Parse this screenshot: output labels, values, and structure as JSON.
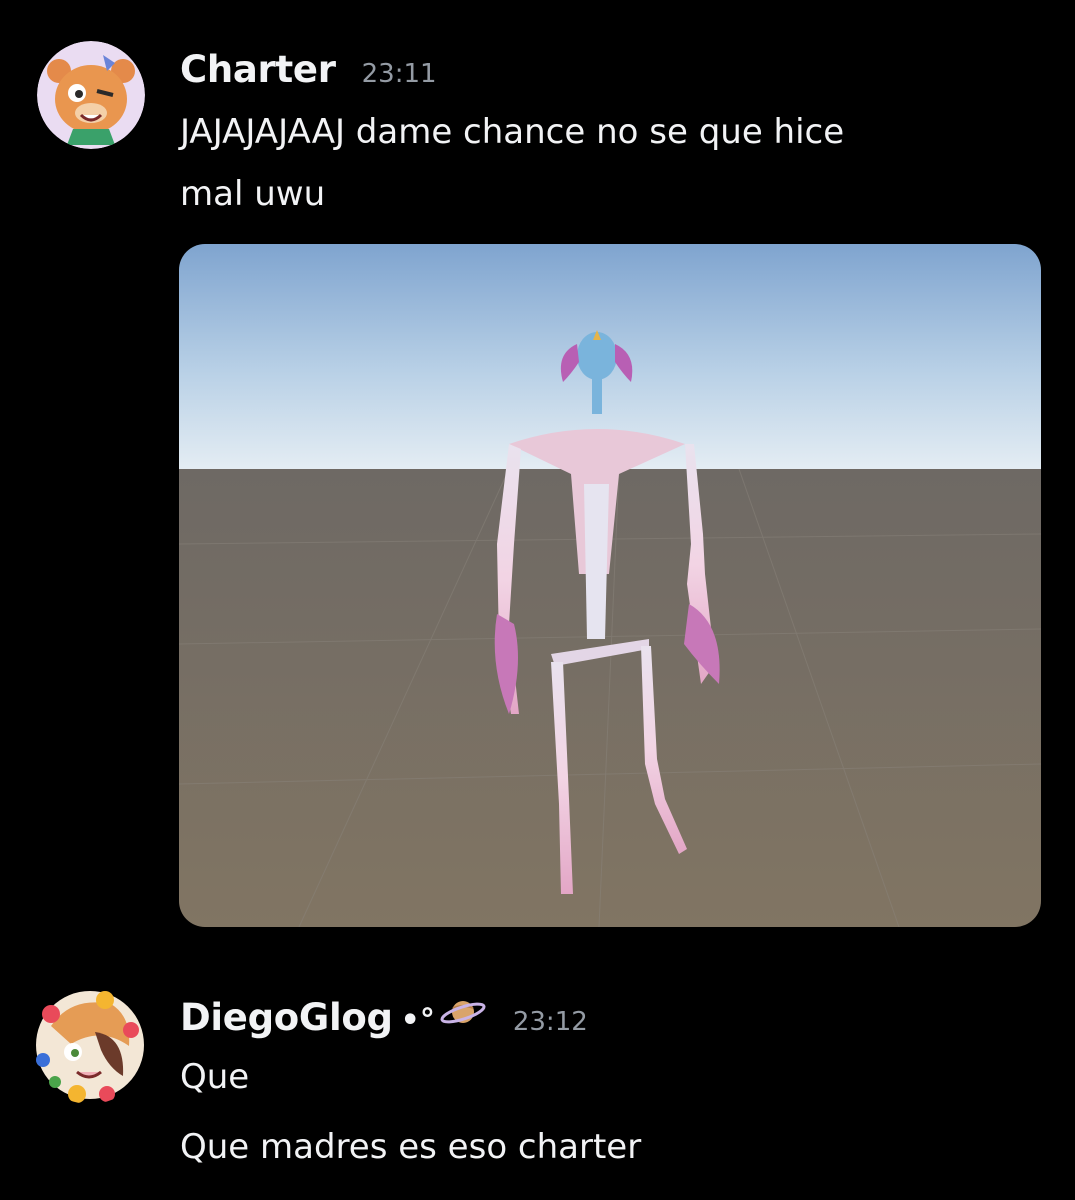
{
  "messages": [
    {
      "author": "Charter",
      "timestamp": "23:11",
      "lines": [
        "JAJAJAJAAJ dame chance no se que hice",
        "mal uwu"
      ],
      "attachment": {
        "type": "image",
        "description_icon": "3d-model-preview"
      }
    },
    {
      "author": "DiegoGlog",
      "decoration": "•°",
      "decoration_icon": "ringed-planet-icon",
      "timestamp": "23:12",
      "lines": [
        "Que",
        "Que madres es eso charter"
      ]
    }
  ],
  "colors": {
    "background": "#000000",
    "username": "#f2f3f5",
    "timestamp": "#949ba4",
    "text": "#f2f3f5"
  }
}
